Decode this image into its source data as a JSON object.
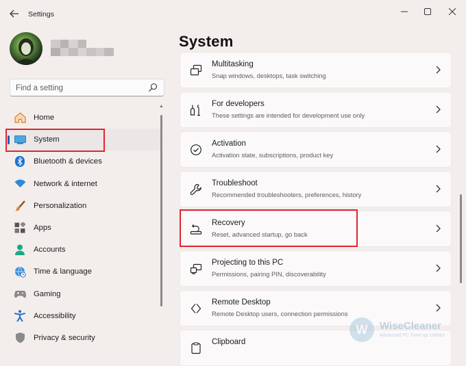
{
  "window": {
    "title": "Settings",
    "back_icon": "back-arrow-icon",
    "controls": [
      "minimize-icon",
      "maximize-icon",
      "close-icon"
    ]
  },
  "profile": {
    "avatar": "user-avatar",
    "name_blurred": true
  },
  "search": {
    "placeholder": "Find a setting",
    "value": ""
  },
  "sidebar": {
    "items": [
      {
        "label": "Home",
        "icon": "home-icon",
        "active": false
      },
      {
        "label": "System",
        "icon": "system-display-icon",
        "active": true
      },
      {
        "label": "Bluetooth & devices",
        "icon": "bluetooth-icon",
        "active": false
      },
      {
        "label": "Network & internet",
        "icon": "wifi-icon",
        "active": false
      },
      {
        "label": "Personalization",
        "icon": "brush-icon",
        "active": false
      },
      {
        "label": "Apps",
        "icon": "apps-icon",
        "active": false
      },
      {
        "label": "Accounts",
        "icon": "accounts-icon",
        "active": false
      },
      {
        "label": "Time & language",
        "icon": "globe-clock-icon",
        "active": false
      },
      {
        "label": "Gaming",
        "icon": "gamepad-icon",
        "active": false
      },
      {
        "label": "Accessibility",
        "icon": "accessibility-icon",
        "active": false
      },
      {
        "label": "Privacy & security",
        "icon": "shield-icon",
        "active": false
      }
    ]
  },
  "main": {
    "title": "System",
    "cards": [
      {
        "title": "Multitasking",
        "subtitle": "Snap windows, desktops, task switching",
        "icon": "multitasking-icon"
      },
      {
        "title": "For developers",
        "subtitle": "These settings are intended for development use only",
        "icon": "developer-tools-icon"
      },
      {
        "title": "Activation",
        "subtitle": "Activation state, subscriptions, product key",
        "icon": "activation-check-icon"
      },
      {
        "title": "Troubleshoot",
        "subtitle": "Recommended troubleshooters, preferences, history",
        "icon": "wrench-icon"
      },
      {
        "title": "Recovery",
        "subtitle": "Reset, advanced startup, go back",
        "icon": "recovery-icon"
      },
      {
        "title": "Projecting to this PC",
        "subtitle": "Permissions, pairing PIN, discoverability",
        "icon": "projecting-icon"
      },
      {
        "title": "Remote Desktop",
        "subtitle": "Remote Desktop users, connection permissions",
        "icon": "remote-desktop-icon"
      },
      {
        "title": "Clipboard",
        "subtitle": "",
        "icon": "clipboard-icon"
      }
    ]
  },
  "watermark": {
    "brand": "WiseCleaner",
    "tagline": "Advanced PC Tune-up Utilities",
    "logo_letter": "W"
  },
  "colors": {
    "accent": "#0067c0",
    "highlight_box": "#e0242e",
    "background": "#f3eeec",
    "card": "#fbf9f9"
  }
}
